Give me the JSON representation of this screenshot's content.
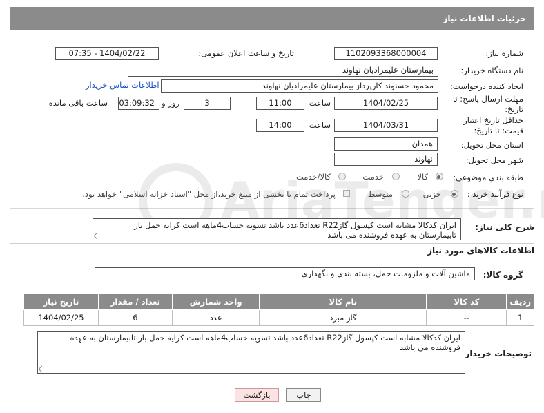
{
  "header": {
    "title": "جزئیات اطلاعات نیاز"
  },
  "form": {
    "need_number": {
      "label": "شماره نیاز:",
      "value": "1102093368000004"
    },
    "announce": {
      "label": "تاریخ و ساعت اعلان عمومی:",
      "value": "1404/02/22 - 07:35"
    },
    "buyer_org": {
      "label": "نام دستگاه خریدار:",
      "value": "بیمارستان علیمرادیان نهاوند"
    },
    "requester": {
      "label": "ایجاد کننده درخواست:",
      "value": "محمود حسنوند کارپرداز بیمارستان علیمرادیان نهاوند",
      "contact_link": "اطلاعات تماس خریدار"
    },
    "deadline": {
      "label": "مهلت ارسال پاسخ: تا تاریخ:",
      "date": "1404/02/25",
      "time_label": "ساعت",
      "time": "11:00",
      "days": "3",
      "days_label": "روز و",
      "remaining": "03:09:32",
      "remaining_label": "ساعت باقی مانده"
    },
    "price_validity": {
      "label": "حداقل تاریخ اعتبار قیمت: تا تاریخ:",
      "date": "1404/03/31",
      "time_label": "ساعت",
      "time": "14:00"
    },
    "province": {
      "label": "استان محل تحویل:",
      "value": "همدان"
    },
    "city": {
      "label": "شهر محل تحویل:",
      "value": "نهاوند"
    },
    "category": {
      "label": "طبقه بندی موضوعی:",
      "options": [
        "کالا",
        "خدمت",
        "کالا/خدمت"
      ]
    },
    "process": {
      "label": "نوع فرآیند خرید :",
      "options": [
        "جزیی",
        "متوسط"
      ],
      "note": "پرداخت تمام یا بخشی از مبلغ خرید،از محل \"اسناد خزانه اسلامی\" خواهد بود."
    }
  },
  "summary": {
    "label": "شرح کلی نیاز:",
    "text": "ایران کدکالا مشابه است کپسول گازR22 تعداد6عدد باشد تسویه حساب4ماهه است کرایه حمل بار تابیمارستان به عهده فروشنده می باشد"
  },
  "goods": {
    "section_title": "اطلاعات کالاهای مورد نیاز",
    "group_label": "گروه کالا:",
    "group_value": "ماشین آلات و ملزومات حمل، بسته بندی و نگهداری",
    "columns": [
      "ردیف",
      "کد کالا",
      "نام کالا",
      "واحد شمارش",
      "تعداد / مقدار",
      "تاریخ نیاز"
    ],
    "rows": [
      {
        "row": "1",
        "code": "--",
        "name": "گاز مبرد",
        "unit": "عدد",
        "qty": "6",
        "date": "1404/02/25"
      }
    ]
  },
  "buyer_notes": {
    "label": "توضیحات خریدار:",
    "text": "ایران کدکالا مشابه است کپسول گازR22 تعداد6عدد باشد تسویه حساب4ماهه است کرایه حمل بار تابیمارستان به عهده فروشنده می باشد"
  },
  "buttons": {
    "print": "چاپ",
    "back": "بازگشت"
  },
  "watermark": {
    "text": "AriaTender.neT"
  }
}
